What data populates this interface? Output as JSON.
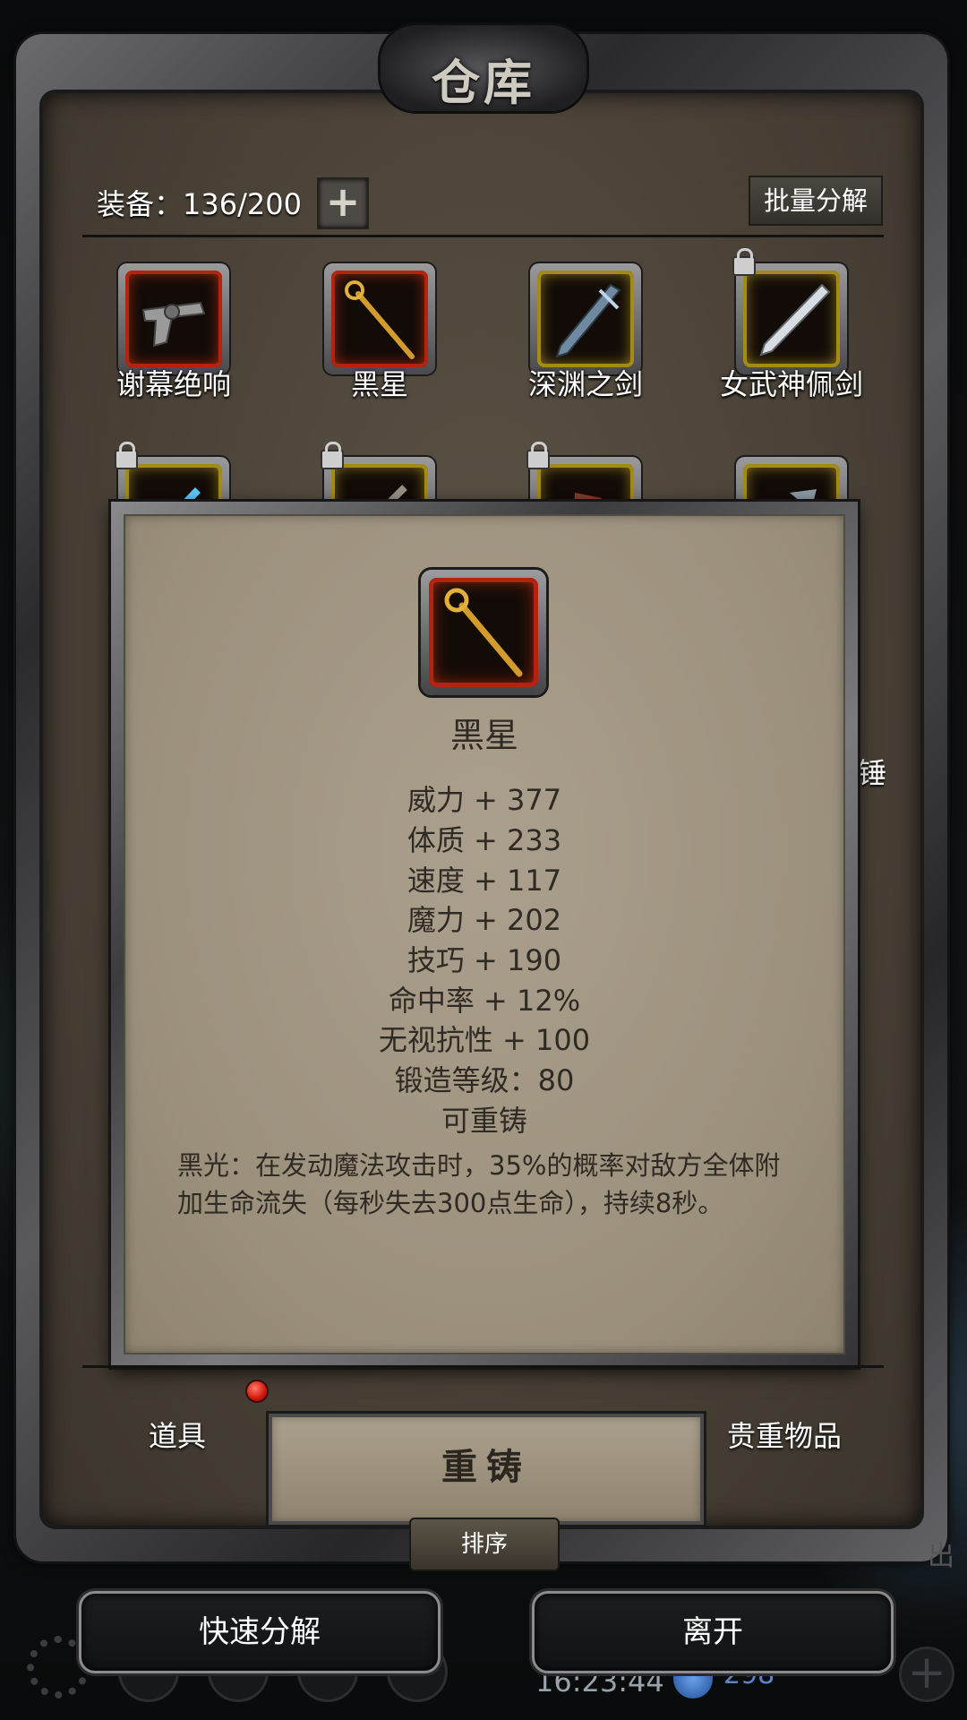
{
  "warehouse": {
    "title": "仓库",
    "capacity_label": "装备：136/200",
    "expand_icon": "+",
    "bulk_decompose_label": "批量分解",
    "sort_label": "排序"
  },
  "grid": {
    "row1": [
      "谢幕绝响",
      "黑星",
      "深渊之剑",
      "女武神佩剑"
    ],
    "peek_right": "锤"
  },
  "detail": {
    "name": "黑星",
    "stats": [
      "威力 + 377",
      "体质 + 233",
      "速度 + 117",
      "魔力 + 202",
      "技巧 + 190",
      "命中率 + 12%",
      "无视抗性 + 100",
      "锻造等级：80"
    ],
    "recastable": "可重铸",
    "effect": "黑光：在发动魔法攻击时，35%的概率对敌方全体附加生命流失（每秒失去300点生命），持续8秒。",
    "recast_label": "重铸"
  },
  "tabs": {
    "items": "道具",
    "valuables": "贵重物品"
  },
  "footer": {
    "quick_decompose": "快速分解",
    "leave": "离开"
  },
  "status": {
    "time": "16:23:44",
    "shield_value": "298",
    "add_icon": "+",
    "side_fragment": "出"
  },
  "colors": {
    "rare_red": "#b3230f",
    "rare_gold": "#a48a16",
    "panel_brown": "#4a4237",
    "popup_parchment": "#9b907c"
  }
}
